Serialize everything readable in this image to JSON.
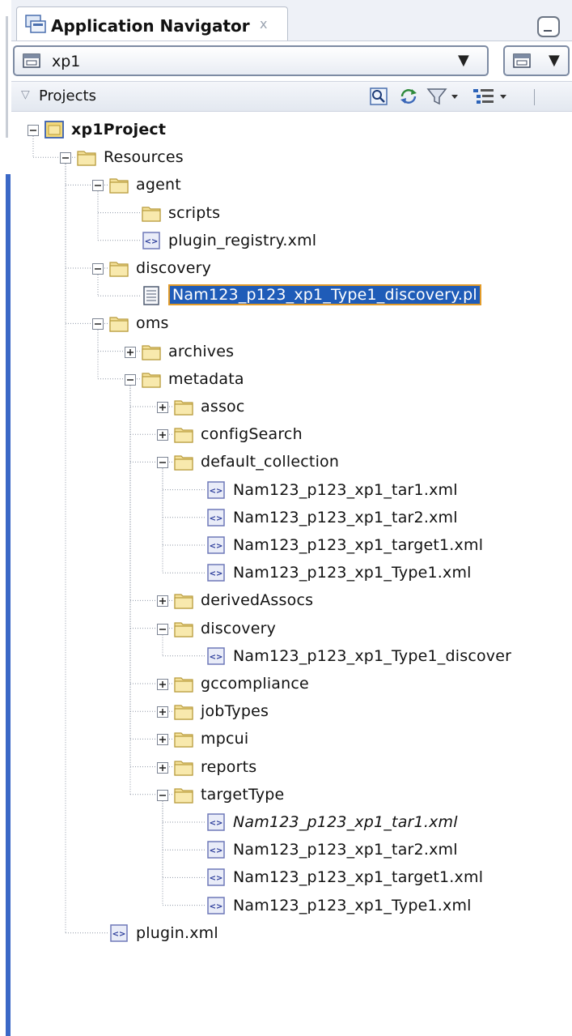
{
  "navigator": {
    "tab_title": "Application Navigator",
    "tab_close": "x",
    "application_selector": "xp1"
  },
  "projects": {
    "title": "Projects"
  },
  "tree": [
    {
      "label": "xp1Project",
      "depth": 0,
      "type": "project",
      "expander": "minus",
      "bold": true
    },
    {
      "label": "Resources",
      "depth": 1,
      "type": "folder",
      "expander": "minus"
    },
    {
      "label": "agent",
      "depth": 2,
      "type": "folder",
      "expander": "minus"
    },
    {
      "label": "scripts",
      "depth": 3,
      "type": "folder",
      "expander": "none"
    },
    {
      "label": "plugin_registry.xml",
      "depth": 3,
      "type": "xml",
      "expander": "none"
    },
    {
      "label": "discovery",
      "depth": 2,
      "type": "folder",
      "expander": "minus"
    },
    {
      "label": "Nam123_p123_xp1_Type1_discovery.pl",
      "depth": 3,
      "type": "text",
      "expander": "none",
      "selected": true
    },
    {
      "label": "oms",
      "depth": 2,
      "type": "folder",
      "expander": "minus"
    },
    {
      "label": "archives",
      "depth": 3,
      "type": "folder",
      "expander": "plus"
    },
    {
      "label": "metadata",
      "depth": 3,
      "type": "folder",
      "expander": "minus"
    },
    {
      "label": "assoc",
      "depth": 4,
      "type": "folder",
      "expander": "plus"
    },
    {
      "label": "configSearch",
      "depth": 4,
      "type": "folder",
      "expander": "plus"
    },
    {
      "label": "default_collection",
      "depth": 4,
      "type": "folder",
      "expander": "minus"
    },
    {
      "label": "Nam123_p123_xp1_tar1.xml",
      "depth": 5,
      "type": "xml",
      "expander": "none"
    },
    {
      "label": "Nam123_p123_xp1_tar2.xml",
      "depth": 5,
      "type": "xml",
      "expander": "none"
    },
    {
      "label": "Nam123_p123_xp1_target1.xml",
      "depth": 5,
      "type": "xml",
      "expander": "none"
    },
    {
      "label": "Nam123_p123_xp1_Type1.xml",
      "depth": 5,
      "type": "xml",
      "expander": "none"
    },
    {
      "label": "derivedAssocs",
      "depth": 4,
      "type": "folder",
      "expander": "plus"
    },
    {
      "label": "discovery",
      "depth": 4,
      "type": "folder",
      "expander": "minus"
    },
    {
      "label": "Nam123_p123_xp1_Type1_discover",
      "depth": 5,
      "type": "xml",
      "expander": "none"
    },
    {
      "label": "gccompliance",
      "depth": 4,
      "type": "folder",
      "expander": "plus"
    },
    {
      "label": "jobTypes",
      "depth": 4,
      "type": "folder",
      "expander": "plus"
    },
    {
      "label": "mpcui",
      "depth": 4,
      "type": "folder",
      "expander": "plus"
    },
    {
      "label": "reports",
      "depth": 4,
      "type": "folder",
      "expander": "plus"
    },
    {
      "label": "targetType",
      "depth": 4,
      "type": "folder",
      "expander": "minus"
    },
    {
      "label": "Nam123_p123_xp1_tar1.xml",
      "depth": 5,
      "type": "xml",
      "expander": "none",
      "italic": true
    },
    {
      "label": "Nam123_p123_xp1_tar2.xml",
      "depth": 5,
      "type": "xml",
      "expander": "none"
    },
    {
      "label": "Nam123_p123_xp1_target1.xml",
      "depth": 5,
      "type": "xml",
      "expander": "none"
    },
    {
      "label": "Nam123_p123_xp1_Type1.xml",
      "depth": 5,
      "type": "xml",
      "expander": "none"
    },
    {
      "label": "plugin.xml",
      "depth": 2,
      "type": "xml",
      "expander": "none"
    }
  ],
  "colors": {
    "selection_fill": "#1f5cb8",
    "selection_border": "#e29b2a",
    "folder": "#f0d98a",
    "accent": "#3b68c6"
  }
}
